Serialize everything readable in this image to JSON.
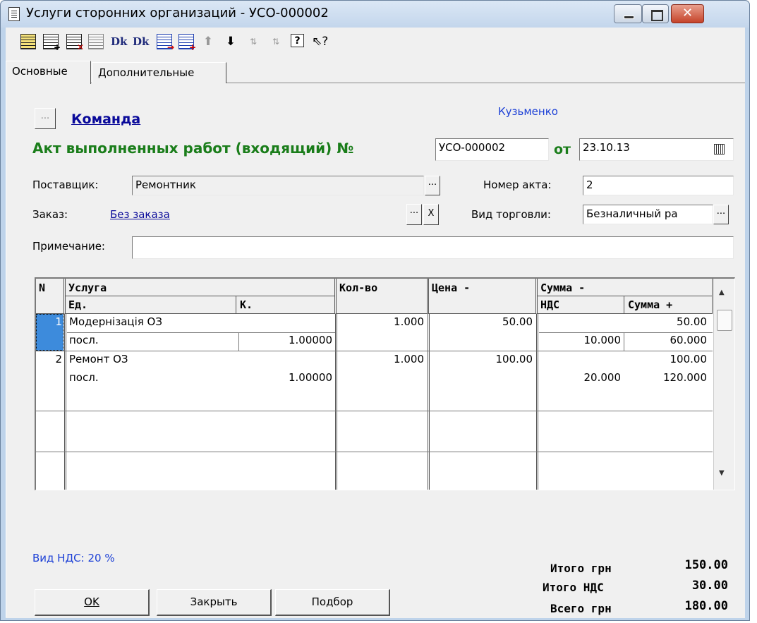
{
  "window": {
    "title": "Услуги сторонних организаций - УСО-000002"
  },
  "toolbar": {
    "icons": [
      "new-row-icon",
      "add-row-icon",
      "delete-row-icon",
      "copy-row-icon",
      "dk-doc-icon",
      "dk-delete-icon",
      "edit-row-icon",
      "move-to-group-icon",
      "arrow-up-icon",
      "arrow-down-icon",
      "sort-asc-icon",
      "sort-desc-icon",
      "help-icon",
      "context-help-icon"
    ],
    "dk_label": "Dk"
  },
  "tabs": [
    "Основные",
    "Дополнительные"
  ],
  "header": {
    "team_link": "Команда",
    "user_name": "Кузьменко",
    "doc_title": "Акт выполненных работ (входящий) №",
    "doc_number": "УСО-000002",
    "date_label": "от",
    "date_value": "23.10.13"
  },
  "form": {
    "supplier_label": "Поставщик:",
    "supplier_value": "Ремонтник",
    "act_number_label": "Номер акта:",
    "act_number_value": "2",
    "order_label": "Заказ:",
    "order_value": "Без заказа",
    "trade_label": "Вид торговли:",
    "trade_value": "Безналичный ра",
    "note_label": "Примечание:",
    "note_value": "",
    "ellipsis": "...",
    "clear": "X"
  },
  "table": {
    "headers": {
      "n": "N",
      "service": "Услуга",
      "unit": "Ед.",
      "k": "К.",
      "qty": "Кол-во",
      "price": "Цена -",
      "sum": "Сумма -",
      "vat": "НДС",
      "sum_plus": "Сумма +"
    },
    "rows": [
      {
        "n": "1",
        "service": "Модернізація ОЗ",
        "unit": "посл.",
        "k": "1.00000",
        "qty": "1.000",
        "price": "50.00",
        "sum": "50.00",
        "vat": "10.000",
        "sum_plus": "60.000"
      },
      {
        "n": "2",
        "service": "Ремонт ОЗ",
        "unit": "посл.",
        "k": "1.00000",
        "qty": "1.000",
        "price": "100.00",
        "sum": "100.00",
        "vat": "20.000",
        "sum_plus": "120.000"
      }
    ]
  },
  "footer": {
    "vat_type": "Вид НДС: 20 %",
    "ok": "OK",
    "close": "Закрыть",
    "pick": "Подбор",
    "totals": [
      {
        "label": "Итого грн",
        "value": "150.00"
      },
      {
        "label": "Итого НДС",
        "value": "30.00"
      },
      {
        "label": "Всего грн",
        "value": "180.00"
      }
    ]
  },
  "colors": {
    "title_green": "#1a7d1a",
    "link_blue": "#0a0a9a",
    "user_blue": "#1b3fd6",
    "selected_cell": "#3d8bdc"
  }
}
